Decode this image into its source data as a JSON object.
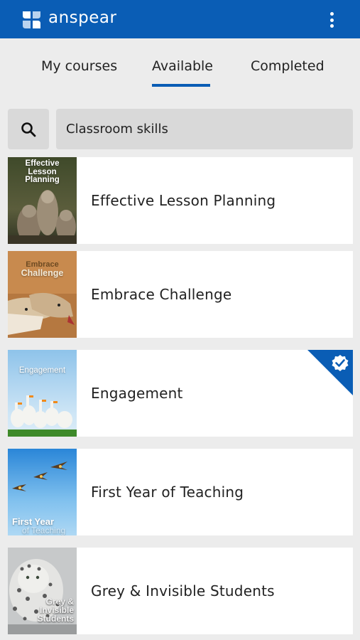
{
  "app": {
    "name": "anspear",
    "brand_color": "#0a5db5"
  },
  "header": {
    "menu_icon": "more-vertical-icon"
  },
  "tabs": [
    {
      "label": "My courses",
      "active": false
    },
    {
      "label": "Available",
      "active": true
    },
    {
      "label": "Completed",
      "active": false
    }
  ],
  "search": {
    "value": "Classroom skills",
    "icon": "search-icon"
  },
  "courses": [
    {
      "title": "Effective Lesson Planning",
      "thumb_text": [
        "Effective",
        "Lesson",
        "Planning"
      ],
      "completed": false
    },
    {
      "title": "Embrace Challenge",
      "thumb_text": [
        "Embrace",
        "Challenge"
      ],
      "completed": false
    },
    {
      "title": "Engagement",
      "thumb_text": [
        "Engagement"
      ],
      "completed": true
    },
    {
      "title": "First Year of Teaching",
      "thumb_text": [
        "First Year",
        "of Teaching"
      ],
      "completed": false
    },
    {
      "title": "Grey & Invisible Students",
      "thumb_text": [
        "Grey &",
        "Invisible",
        "Students"
      ],
      "completed": false
    }
  ]
}
